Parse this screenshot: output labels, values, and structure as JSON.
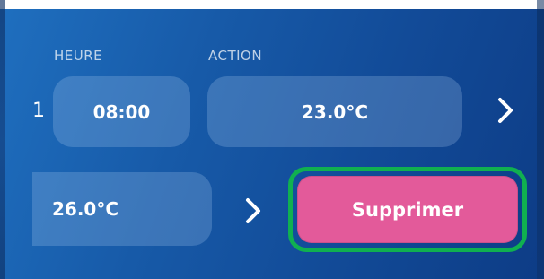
{
  "schedule": {
    "columns": {
      "time_label": "HEURE",
      "action_label": "ACTION"
    },
    "rows": [
      {
        "index": "1",
        "time": "08:00",
        "action_value": "23.0°C"
      },
      {
        "index": "",
        "time": "",
        "action_value": "26.0°C"
      }
    ],
    "delete_label": "Supprimer"
  },
  "icons": {
    "next": "chevron-right-icon"
  },
  "colors": {
    "background_start": "#1f6fbf",
    "background_end": "#0d3c86",
    "pill_bg": "#4a84c8",
    "delete_bg": "#e35a9a",
    "highlight_outline": "#10b050"
  }
}
